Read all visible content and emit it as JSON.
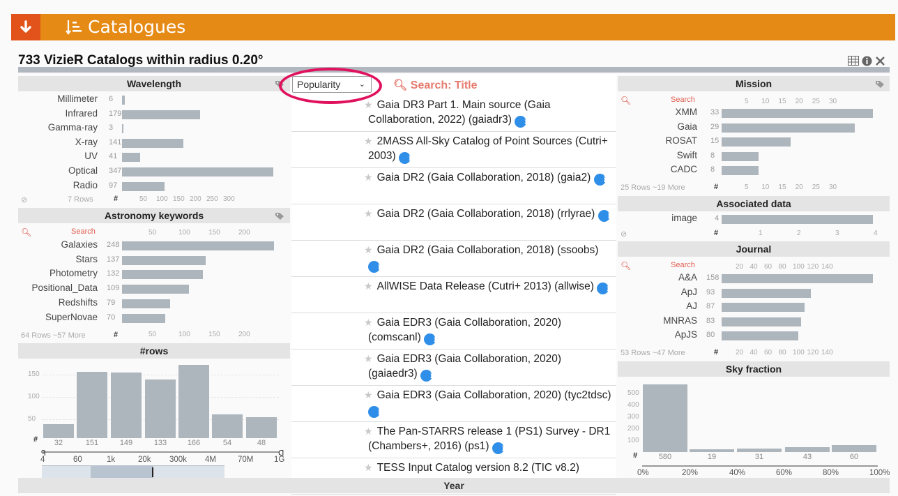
{
  "header": {
    "title": "Catalogues"
  },
  "subheader": {
    "title": "733 VizieR Catalogs within radius 0.20°"
  },
  "wavelength": {
    "title": "Wavelength",
    "items": [
      {
        "label": "Millimeter",
        "count": "6",
        "value": 6
      },
      {
        "label": "Infrared",
        "count": "179",
        "value": 179
      },
      {
        "label": "Gamma-ray",
        "count": "3",
        "value": 3
      },
      {
        "label": "X-ray",
        "count": "141",
        "value": 141
      },
      {
        "label": "UV",
        "count": "41",
        "value": 41
      },
      {
        "label": "Optical",
        "count": "347",
        "value": 347
      },
      {
        "label": "Radio",
        "count": "97",
        "value": 97
      }
    ],
    "footer": "7 Rows",
    "axis_hash": "#",
    "ticks": [
      "50",
      "100",
      "150",
      "200",
      "250",
      "300"
    ]
  },
  "astro": {
    "title": "Astronomy keywords",
    "search_label": "Search",
    "ticks": [
      "50",
      "100",
      "150",
      "200"
    ],
    "items": [
      {
        "label": "Galaxies",
        "count": "248",
        "value": 248
      },
      {
        "label": "Stars",
        "count": "137",
        "value": 137
      },
      {
        "label": "Photometry",
        "count": "132",
        "value": 132
      },
      {
        "label": "Positional_Data",
        "count": "109",
        "value": 109
      },
      {
        "label": "Redshifts",
        "count": "79",
        "value": 79
      },
      {
        "label": "SuperNovae",
        "count": "70",
        "value": 70
      }
    ],
    "footer": "64 Rows ~57 More",
    "axis_hash": "#"
  },
  "rows": {
    "title": "#rows",
    "yticks": [
      "150",
      "100",
      "50"
    ],
    "counts": [
      "32",
      "151",
      "149",
      "133",
      "166",
      "54",
      "48"
    ],
    "values": [
      32,
      151,
      149,
      133,
      166,
      54,
      48
    ],
    "xticks": [
      "4",
      "60",
      "1k",
      "20k",
      "300k",
      "4M",
      "70M",
      "1G"
    ],
    "hash": "#"
  },
  "sort": {
    "selected": "Popularity"
  },
  "search": {
    "label": "Search: Title"
  },
  "catalogs": [
    {
      "title": "Gaia DR3 Part 1. Main source (Gaia Collaboration, 2022) (gaiadr3)"
    },
    {
      "title": "2MASS All-Sky Catalog of Point Sources (Cutri+ 2003)"
    },
    {
      "title": "Gaia DR2 (Gaia Collaboration, 2018) (gaia2)"
    },
    {
      "title": "Gaia DR2 (Gaia Collaboration, 2018) (rrlyrae)"
    },
    {
      "title": "Gaia DR2 (Gaia Collaboration, 2018) (ssoobs)"
    },
    {
      "title": "AllWISE Data Release (Cutri+ 2013) (allwise)"
    },
    {
      "title": "Gaia EDR3 (Gaia Collaboration, 2020) (comscanl)"
    },
    {
      "title": "Gaia EDR3 (Gaia Collaboration, 2020) (gaiaedr3)"
    },
    {
      "title": "Gaia EDR3 (Gaia Collaboration, 2020) (tyc2tdsc)"
    },
    {
      "title": "The Pan-STARRS release 1 (PS1) Survey - DR1 (Chambers+, 2016) (ps1)"
    },
    {
      "title": "TESS Input Catalog version 8.2 (TIC v8.2)"
    }
  ],
  "mission": {
    "title": "Mission",
    "search_label": "Search",
    "ticks": [
      "5",
      "10",
      "15",
      "20",
      "25",
      "30"
    ],
    "items": [
      {
        "label": "XMM",
        "count": "33",
        "value": 33
      },
      {
        "label": "Gaia",
        "count": "29",
        "value": 29
      },
      {
        "label": "ROSAT",
        "count": "15",
        "value": 15
      },
      {
        "label": "Swift",
        "count": "8",
        "value": 8
      },
      {
        "label": "CADC",
        "count": "8",
        "value": 8
      }
    ],
    "footer": "25 Rows ~19 More",
    "axis_hash": "#"
  },
  "assoc": {
    "title": "Associated data",
    "items": [
      {
        "label": "image",
        "count": "4",
        "value": 4
      }
    ],
    "ticks": [
      "1",
      "2",
      "3",
      "4"
    ],
    "axis_hash": "#"
  },
  "journal": {
    "title": "Journal",
    "search_label": "Search",
    "ticks": [
      "20",
      "40",
      "60",
      "80",
      "100",
      "120",
      "140"
    ],
    "items": [
      {
        "label": "A&A",
        "count": "158",
        "value": 158
      },
      {
        "label": "ApJ",
        "count": "93",
        "value": 93
      },
      {
        "label": "AJ",
        "count": "87",
        "value": 87
      },
      {
        "label": "MNRAS",
        "count": "83",
        "value": 83
      },
      {
        "label": "ApJS",
        "count": "80",
        "value": 80
      }
    ],
    "footer": "53 Rows ~47 More",
    "axis_hash": "#"
  },
  "sky": {
    "title": "Sky fraction",
    "yticks": [
      "500",
      "400",
      "300",
      "200",
      "100"
    ],
    "counts": [
      "580",
      "19",
      "31",
      "43",
      "60"
    ],
    "values": [
      580,
      19,
      31,
      43,
      60
    ],
    "xticks": [
      "0%",
      "20%",
      "40%",
      "60%",
      "80%",
      "100%"
    ],
    "hash": "#"
  },
  "year": {
    "title": "Year"
  },
  "colors": {
    "orange": "#e68a16",
    "red_orange": "#e2531c",
    "bar": "#aeb6bd",
    "highlight": "#e0125e",
    "info": "#2f8ee8"
  }
}
